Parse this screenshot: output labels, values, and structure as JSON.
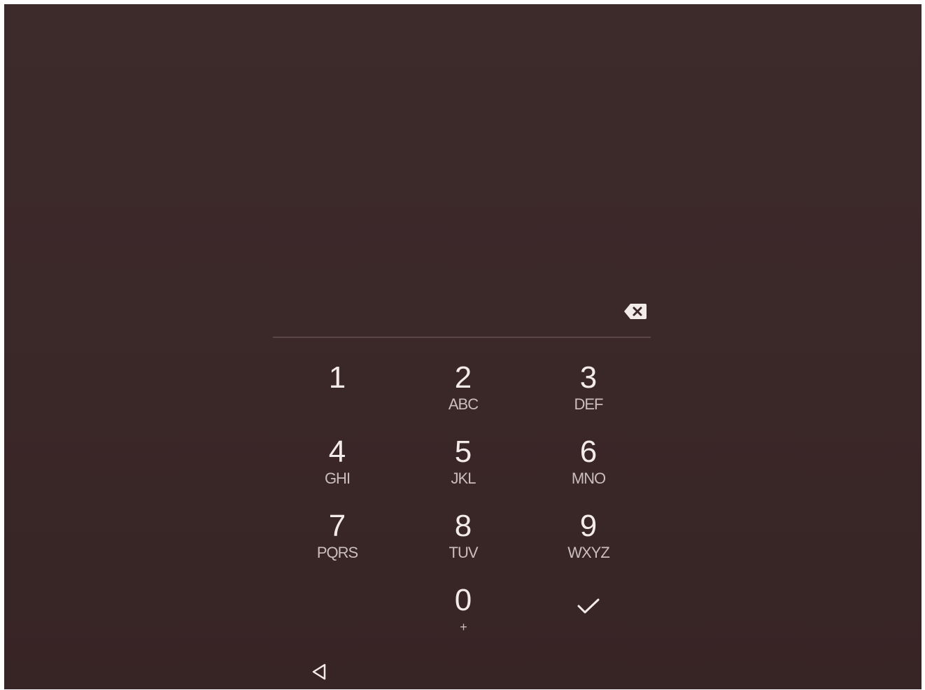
{
  "pin": {
    "entered": ""
  },
  "keypad": {
    "keys": [
      {
        "digit": "1",
        "letters": ""
      },
      {
        "digit": "2",
        "letters": "ABC"
      },
      {
        "digit": "3",
        "letters": "DEF"
      },
      {
        "digit": "4",
        "letters": "GHI"
      },
      {
        "digit": "5",
        "letters": "JKL"
      },
      {
        "digit": "6",
        "letters": "MNO"
      },
      {
        "digit": "7",
        "letters": "PQRS"
      },
      {
        "digit": "8",
        "letters": "TUV"
      },
      {
        "digit": "9",
        "letters": "WXYZ"
      },
      {
        "digit": "0",
        "letters": "+"
      }
    ],
    "delete_icon": "backspace-icon",
    "confirm_icon": "checkmark-icon"
  },
  "navigation": {
    "back_icon": "back-triangle-icon"
  },
  "colors": {
    "background": "#3b2829",
    "text": "#f3eaea",
    "subtext": "#cbbebe",
    "divider": "#5a4647"
  }
}
